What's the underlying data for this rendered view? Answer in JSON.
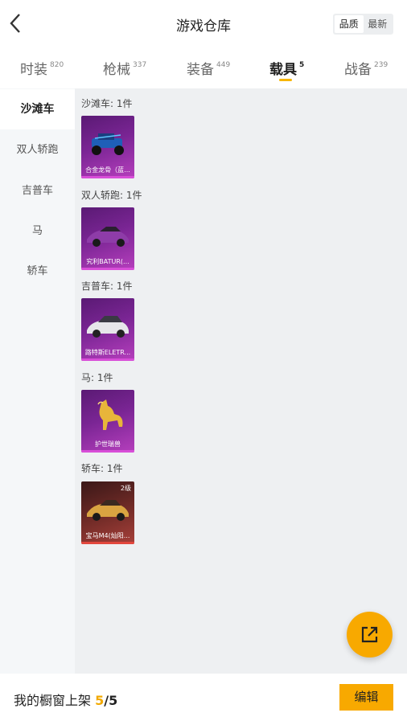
{
  "header": {
    "title": "游戏仓库",
    "sort_options": [
      "品质",
      "最新"
    ]
  },
  "tabs": [
    {
      "label": "时装",
      "count": "820"
    },
    {
      "label": "枪械",
      "count": "337"
    },
    {
      "label": "装备",
      "count": "449"
    },
    {
      "label": "载具",
      "count": "5"
    },
    {
      "label": "战备",
      "count": "239"
    }
  ],
  "sidebar": {
    "items": [
      "沙滩车",
      "双人轿跑",
      "吉普车",
      "马",
      "轿车"
    ]
  },
  "groups": [
    {
      "label": "沙滩车: 1件",
      "item": {
        "name": "合金龙骨（蓝..."
      }
    },
    {
      "label": "双人轿跑: 1件",
      "item": {
        "name": "究利BATUR(..."
      }
    },
    {
      "label": "吉普车: 1件",
      "item": {
        "name": "路特斯ELETR..."
      }
    },
    {
      "label": "马: 1件",
      "item": {
        "name": "护世瑞兽"
      }
    },
    {
      "label": "轿车: 1件",
      "item": {
        "name": "宝马M4(灿阳...",
        "level": "2级"
      }
    }
  ],
  "bottom": {
    "label": "我的橱窗上架",
    "current": "5",
    "separator": "/",
    "max": "5",
    "edit_label": "编辑"
  },
  "colors": {
    "accent": "#f8a900",
    "purple_rarity": "#b63fbd",
    "red_rarity": "#e2473d"
  },
  "icons": {
    "back": "chevron-left-icon",
    "share": "external-link-icon"
  }
}
